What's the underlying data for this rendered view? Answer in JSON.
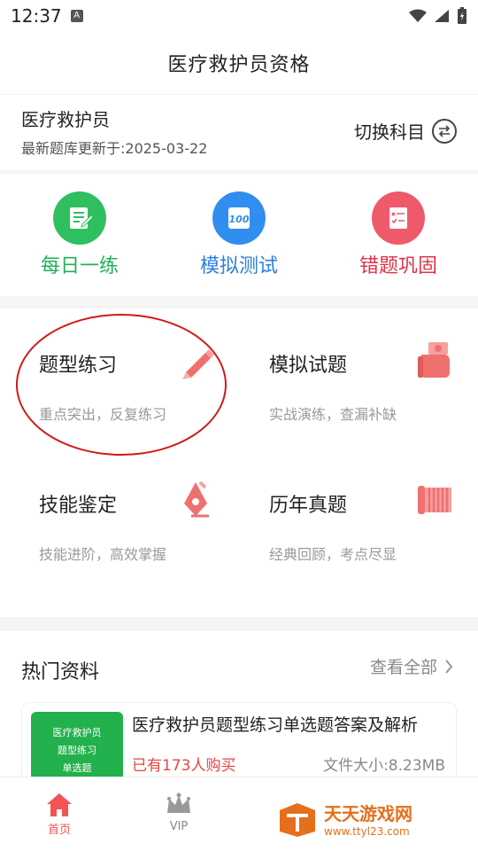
{
  "status": {
    "time": "12:37"
  },
  "header": {
    "title": "医疗救护员资格"
  },
  "subject": {
    "name": "医疗救护员",
    "updated": "最新题库更新于:2025-03-22",
    "switch_label": "切换科目"
  },
  "quick": [
    {
      "label": "每日一练",
      "color": "#1fb05a"
    },
    {
      "label": "模拟测试",
      "color": "#2f7de0"
    },
    {
      "label": "错题巩固",
      "color": "#e0334a"
    }
  ],
  "grid": [
    {
      "title": "题型练习",
      "desc": "重点突出，反复练习"
    },
    {
      "title": "模拟试题",
      "desc": "实战演练，查漏补缺"
    },
    {
      "title": "技能鉴定",
      "desc": "技能进阶，高效掌握"
    },
    {
      "title": "历年真题",
      "desc": "经典回顾，考点尽显"
    }
  ],
  "hot": {
    "heading": "热门资料",
    "more": "查看全部",
    "card": {
      "thumb_lines": [
        "医疗救护员",
        "题型练习",
        "单选题"
      ],
      "title": "医疗救护员题型练习单选题答案及解析",
      "buyers": "已有173人购买",
      "size": "文件大小:8.23MB"
    }
  },
  "tabs": [
    {
      "label": "首页",
      "active": true
    },
    {
      "label": "VIP",
      "active": false
    }
  ],
  "watermark": {
    "name": "天天游戏网",
    "url": "www.ttyl23.com"
  }
}
